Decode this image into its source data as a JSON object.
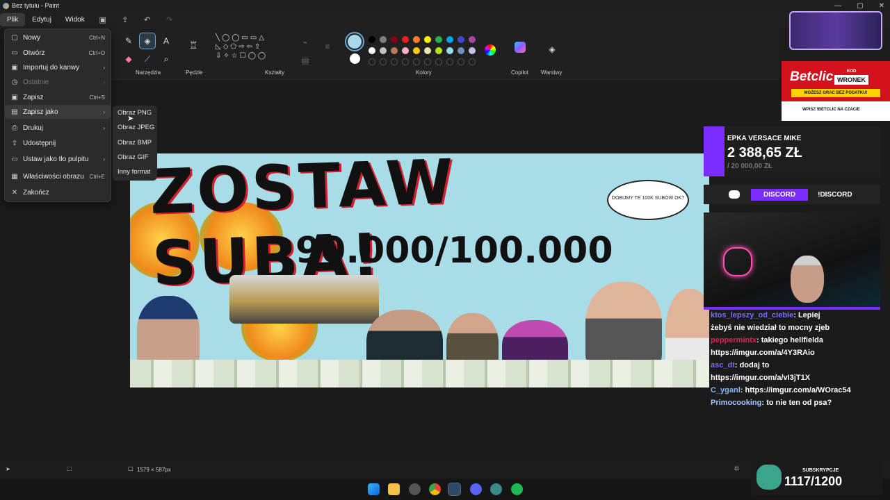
{
  "titlebar": {
    "title": "Bez tytułu - Paint",
    "min": "—",
    "max": "▢",
    "close": "✕"
  },
  "menubar": {
    "items": [
      "Plik",
      "Edytuj",
      "Widok"
    ]
  },
  "ribbon": {
    "groups": {
      "tools": "Narzędzia",
      "brushes": "Pędzle",
      "shapes": "Kształty",
      "colors": "Kolory",
      "copilot": "Copilot",
      "layers": "Warstwy"
    }
  },
  "colors": {
    "active": "#a8d8ea",
    "row1": [
      "#000000",
      "#7f7f7f",
      "#880015",
      "#ed1c24",
      "#ff7f27",
      "#fff200",
      "#22b14c",
      "#00a2e8",
      "#3f48cc",
      "#a349a4"
    ],
    "row2": [
      "#ffffff",
      "#c3c3c3",
      "#b97a57",
      "#ffaec9",
      "#ffc90e",
      "#efe4b0",
      "#b5e61d",
      "#99d9ea",
      "#7092be",
      "#c8bfe7"
    ]
  },
  "filemenu": {
    "items": [
      {
        "label": "Nowy",
        "shortcut": "Ctrl+N"
      },
      {
        "label": "Otwórz",
        "shortcut": "Ctrl+O"
      },
      {
        "label": "Importuj do kanwy",
        "shortcut": ""
      },
      {
        "label": "Ostatnie",
        "shortcut": ""
      },
      {
        "label": "Zapisz",
        "shortcut": "Ctrl+S"
      },
      {
        "label": "Zapisz jako",
        "shortcut": ""
      },
      {
        "label": "Drukuj",
        "shortcut": ""
      },
      {
        "label": "Udostępnij",
        "shortcut": ""
      },
      {
        "label": "Ustaw jako tło pulpitu",
        "shortcut": ""
      },
      {
        "label": "Właściwości obrazu",
        "shortcut": "Ctrl+E"
      },
      {
        "label": "Zakończ",
        "shortcut": ""
      }
    ]
  },
  "submenu": {
    "items": [
      "Obraz PNG",
      "Obraz JPEG",
      "Obraz BMP",
      "Obraz GIF",
      "Inny format"
    ]
  },
  "canvas": {
    "title": "ZOSTAW SUBA!",
    "counter": "90.000/100.000",
    "bubble": "DOBIJMY TE 100K SUBÓW OK?"
  },
  "statusbar": {
    "size": "1579 × 587px"
  },
  "overlay": {
    "betclic_brand": "Betclic",
    "betclic_code_label": "KOD",
    "betclic_code": "WRONEK",
    "betclic_tagline": "MOŻESZ GRAĆ BEZ PODATKU!",
    "betclic_hint": "WPISZ !BETCLIC NA CZACIE",
    "donation_title": "EPKA VERSACE MIKE",
    "donation_amount": "2 388,65 ZŁ",
    "donation_goal": "/ 20 000,00 ZŁ",
    "discord_button": "DISCORD",
    "discord_command": "!DISCORD",
    "chat": [
      {
        "user": "ktos_lepszy_od_ciebie",
        "text": ": Lepiej",
        "color": "#7b6cff"
      },
      {
        "user": "",
        "text": "żebyś nie wiedział to mocny zjeb",
        "color": "#ffffff"
      },
      {
        "user": "peppermintx",
        "text": ": takiego hellfielda",
        "color": "#d6245a"
      },
      {
        "user": "",
        "text": "https://imgur.com/a/4Y3RAio",
        "color": "#ffffff"
      },
      {
        "user": "asc_dt",
        "text": ": dodaj to",
        "color": "#7b6cff"
      },
      {
        "user": "",
        "text": "https://imgur.com/a/vI3jT1X",
        "color": "#ffffff"
      },
      {
        "user": "C_yganl",
        "text": ": https://imgur.com/a/WOrac54",
        "color": "#7fb6ff"
      },
      {
        "user": "Primocooking",
        "text": ": to nie ten od psa?",
        "color": "#9fc8ff"
      }
    ],
    "subs_label": "SUBSKRYPCJE",
    "subs_value": "1117/1200"
  }
}
